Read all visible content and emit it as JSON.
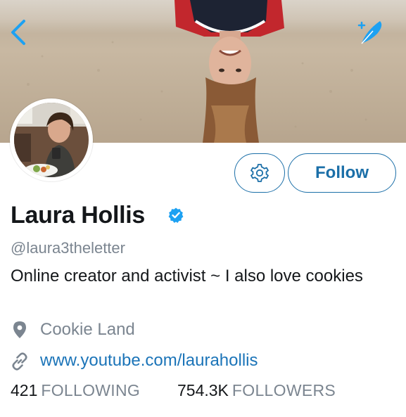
{
  "profile": {
    "display_name": "Laura Hollis",
    "handle": "@laura3theletter",
    "bio": "Online creator and activist ~ I also love cookies",
    "location": "Cookie Land",
    "website": "www.youtube.com/laurahollis",
    "verified": true
  },
  "actions": {
    "follow_label": "Follow"
  },
  "stats": {
    "following_count": "421",
    "following_label": "FOLLOWING",
    "followers_count": "754.3K",
    "followers_label": "FOLLOWERS"
  },
  "icons": {
    "back": "chevron-left-icon",
    "compose": "feather-quill-icon",
    "settings": "gear-icon",
    "verified": "verified-check-icon",
    "location": "map-pin-icon",
    "link": "chain-link-icon"
  },
  "colors": {
    "accent": "#1b6fa8",
    "link": "#1b74b8",
    "verified": "#1da1f2",
    "muted": "#7b8590",
    "text": "#14171a"
  }
}
